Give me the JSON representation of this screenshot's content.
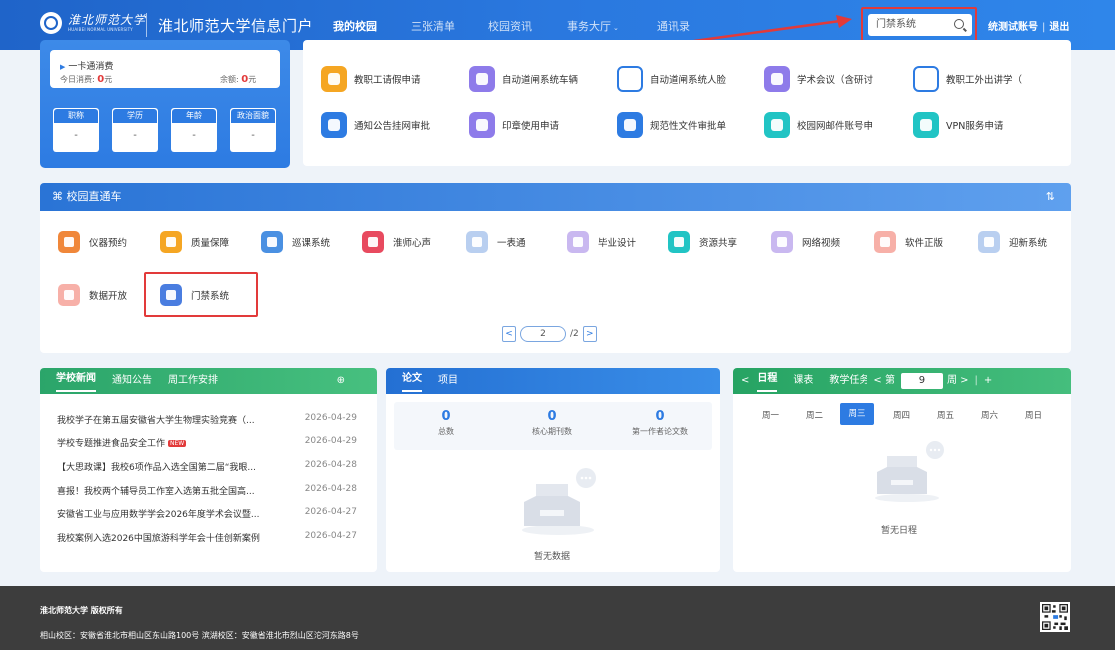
{
  "header": {
    "logo_cn": "淮北师范大学",
    "logo_en": "HUAIBEI NORMAL UNIVERSITY",
    "portal_title": "淮北师范大学信息门户",
    "nav": [
      "我的校园",
      "三张清单",
      "校园资讯",
      "事务大厅",
      "通讯录"
    ],
    "search_value": "门禁系统",
    "user": "统测试账号",
    "logout": "退出"
  },
  "card": {
    "title": "一卡通消费",
    "today_label": "今日消费:",
    "today_value": "0",
    "today_unit": "元",
    "balance_label": "余额:",
    "balance_value": "0",
    "balance_unit": "元",
    "stats": [
      {
        "label": "职称",
        "value": "-"
      },
      {
        "label": "学历",
        "value": "-"
      },
      {
        "label": "年龄",
        "value": "-"
      },
      {
        "label": "政治面貌",
        "value": "-"
      }
    ]
  },
  "apps": [
    {
      "label": "教职工请假申请",
      "color": "#f5a623"
    },
    {
      "label": "自动道闸系统车辆",
      "color": "#8e7bea"
    },
    {
      "label": "自动道闸系统人脸",
      "color": "#ffffff"
    },
    {
      "label": "学术会议（含研讨",
      "color": "#8e7bea"
    },
    {
      "label": "教职工外出讲学（",
      "color": "#ffffff"
    },
    {
      "label": "通知公告挂网审批",
      "color": "#2d7be2"
    },
    {
      "label": "印章使用申请",
      "color": "#8e7bea"
    },
    {
      "label": "规范性文件审批单",
      "color": "#2d7be2"
    },
    {
      "label": "校园网邮件账号申",
      "color": "#21c4c4"
    },
    {
      "label": "VPN服务申请",
      "color": "#21c4c4"
    }
  ],
  "direct": {
    "title": "校园直通车",
    "apps": [
      {
        "label": "仪器预约",
        "color": "#f0873a"
      },
      {
        "label": "质量保障",
        "color": "#f5a623"
      },
      {
        "label": "巡课系统",
        "color": "#4a90e2"
      },
      {
        "label": "淮师心声",
        "color": "#e84a5f"
      },
      {
        "label": "一表通",
        "color": "#b9cff0"
      },
      {
        "label": "毕业设计",
        "color": "#c9b8f0"
      },
      {
        "label": "资源共享",
        "color": "#21c4c4"
      },
      {
        "label": "网络视频",
        "color": "#c9b8f0"
      },
      {
        "label": "软件正版",
        "color": "#f7b0a8"
      },
      {
        "label": "迎新系统",
        "color": "#b9cff0"
      },
      {
        "label": "数据开放",
        "color": "#f7b0a8"
      },
      {
        "label": "门禁系统",
        "color": "#4a7de0"
      }
    ],
    "page": "2",
    "total": "/2"
  },
  "news": {
    "tabs": [
      "学校新闻",
      "通知公告",
      "周工作安排"
    ],
    "items": [
      {
        "title": "我校学子在第五届安徽省大学生物理实验竞赛（...",
        "date": "2026-04-29"
      },
      {
        "title": "学校专题推进食品安全工作",
        "date": "2026-04-29",
        "badge": "NEW"
      },
      {
        "title": "【大思政课】我校6项作品入选全国第二届“我眼...",
        "date": "2026-04-28"
      },
      {
        "title": "喜报！我校两个辅导员工作室入选第五批全国高...",
        "date": "2026-04-28"
      },
      {
        "title": "安徽省工业与应用数学学会2026年度学术会议暨...",
        "date": "2026-04-27"
      },
      {
        "title": "我校案例入选2026中国旅游科学年会十佳创新案例",
        "date": "2026-04-27"
      }
    ]
  },
  "papers": {
    "tabs": [
      "论文",
      "项目"
    ],
    "stats": [
      {
        "value": "0",
        "label": "总数"
      },
      {
        "value": "0",
        "label": "核心期刊数"
      },
      {
        "value": "0",
        "label": "第一作者论文数"
      }
    ],
    "empty": "暂无数据"
  },
  "schedule": {
    "tabs": [
      "日程",
      "课表",
      "教学任务"
    ],
    "week_prefix": "< 第",
    "week": "9",
    "week_suffix": "周 >",
    "days": [
      "周一",
      "周二",
      "周三",
      "周四",
      "周五",
      "周六",
      "周日"
    ],
    "empty": "暂无日程"
  },
  "footer": {
    "copyright": "淮北师范大学 版权所有",
    "address": "相山校区：安徽省淮北市相山区东山路100号 滨湖校区：安徽省淮北市烈山区沱河东路8号"
  }
}
